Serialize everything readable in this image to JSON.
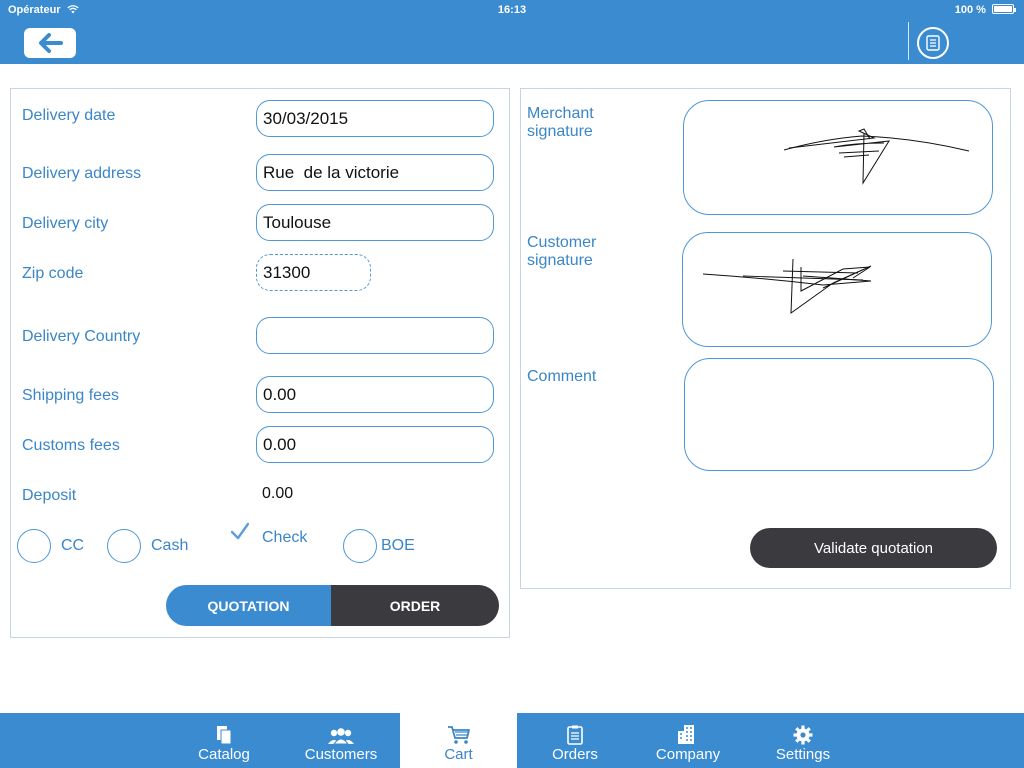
{
  "status_bar": {
    "carrier": "Opérateur",
    "time": "16:13",
    "battery": "100 %"
  },
  "toolbar": {
    "back_icon": "arrow-left-icon",
    "doc_icon": "document-icon"
  },
  "form": {
    "delivery_date": {
      "label": "Delivery date",
      "value": "30/03/2015"
    },
    "delivery_address": {
      "label": "Delivery address",
      "value": "Rue  de la victorie"
    },
    "delivery_city": {
      "label": "Delivery city",
      "value": "Toulouse"
    },
    "zip_code": {
      "label": "Zip code",
      "value": "31300"
    },
    "delivery_country": {
      "label": "Delivery Country",
      "value": ""
    },
    "shipping_fees": {
      "label": "Shipping fees",
      "value": "0.00"
    },
    "customs_fees": {
      "label": "Customs fees",
      "value": "0.00"
    },
    "deposit": {
      "label": "Deposit",
      "value": "0.00"
    }
  },
  "payment": {
    "options": [
      {
        "label": "CC",
        "selected": false
      },
      {
        "label": "Cash",
        "selected": false
      },
      {
        "label": "Check",
        "selected": true
      },
      {
        "label": "BOE",
        "selected": false
      }
    ]
  },
  "mode": {
    "quotation_label": "QUOTATION",
    "order_label": "ORDER",
    "selected": "QUOTATION"
  },
  "signatures": {
    "merchant_label": "Merchant signature",
    "customer_label": "Customer signature",
    "comment_label": "Comment",
    "comment_value": ""
  },
  "validate_label": "Validate quotation",
  "tabs": [
    {
      "label": "Catalog",
      "icon": "catalog-icon",
      "active": false
    },
    {
      "label": "Customers",
      "icon": "customers-icon",
      "active": false
    },
    {
      "label": "Cart",
      "icon": "cart-icon",
      "active": true
    },
    {
      "label": "Orders",
      "icon": "orders-icon",
      "active": false
    },
    {
      "label": "Company",
      "icon": "company-icon",
      "active": false
    },
    {
      "label": "Settings",
      "icon": "gear-icon",
      "active": false
    }
  ],
  "colors": {
    "accent": "#3a8bd0",
    "label": "#3a86c8",
    "dark_button": "#3b3b3f"
  }
}
